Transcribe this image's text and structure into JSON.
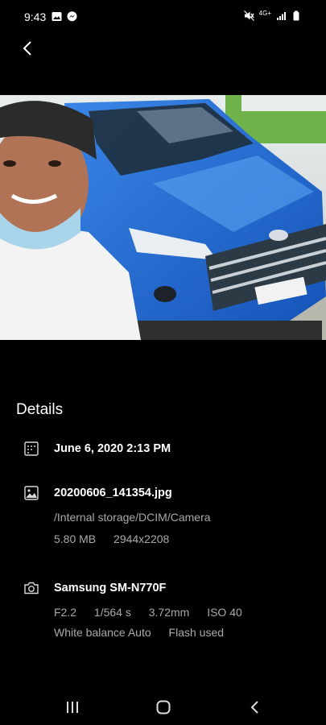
{
  "status_bar": {
    "time": "9:43",
    "left_icons": [
      "gallery-notification-icon",
      "messenger-icon"
    ],
    "right_icons": [
      "mute-icon",
      "4g-plus-icon",
      "signal-icon",
      "battery-icon"
    ],
    "network_label": "4G+"
  },
  "header": {
    "back_icon": "chevron-left-icon"
  },
  "photo": {
    "description_icon": "photo-image"
  },
  "details": {
    "title": "Details",
    "date": {
      "icon": "calendar-icon",
      "value": "June 6, 2020 2:13 PM"
    },
    "file": {
      "icon": "image-icon",
      "name": "20200606_141354.jpg",
      "path": "/Internal storage/DCIM/Camera",
      "size": "5.80 MB",
      "resolution": "2944x2208"
    },
    "camera": {
      "icon": "camera-icon",
      "model": "Samsung SM-N770F",
      "aperture": "F2.2",
      "shutter": "1/564 s",
      "focal_length": "3.72mm",
      "iso": "ISO 40",
      "white_balance": "White balance Auto",
      "flash": "Flash used"
    }
  },
  "nav_bar": {
    "recents_icon": "recents-icon",
    "home_icon": "home-icon",
    "back_icon": "back-icon"
  }
}
